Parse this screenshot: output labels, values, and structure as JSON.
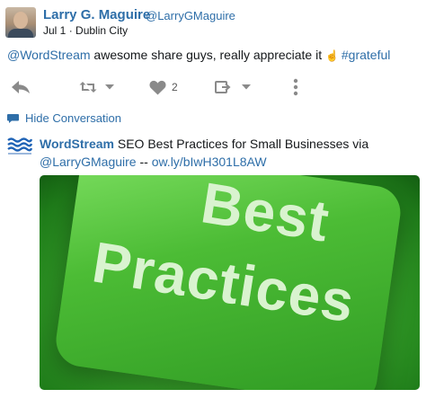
{
  "tweet": {
    "author_name": "Larry G. Maguire",
    "author_handle": "@LarryGMaguire",
    "date": "Jul 1",
    "separator": "·",
    "location": "Dublin City",
    "mention": "@WordStream",
    "body": " awesome share guys, really appreciate it ",
    "hand_glyph": "☝",
    "hashtag": "#grateful",
    "like_count": "2"
  },
  "icons": {
    "reply": "reply-icon",
    "retweet": "retweet-icon",
    "like": "heart-icon",
    "share": "share-icon",
    "more": "more-vertical-icon",
    "conversation": "speech-bubble-icon",
    "logo": "wordstream-logo-icon"
  },
  "conversation": {
    "toggle_label": "Hide Conversation"
  },
  "retweeted": {
    "author_name": "WordStream",
    "text_before": " SEO Best Practices for Small Businesses via ",
    "mention": "@LarryGMaguire",
    "dashes": " -- ",
    "link": "ow.ly/bIwH301L8AW"
  },
  "image": {
    "line1": "Best",
    "line2": "Practices"
  },
  "colors": {
    "link_blue": "#2e6ea8",
    "icon_gray": "#8a8a8a",
    "key_green": "#4cbc35"
  }
}
